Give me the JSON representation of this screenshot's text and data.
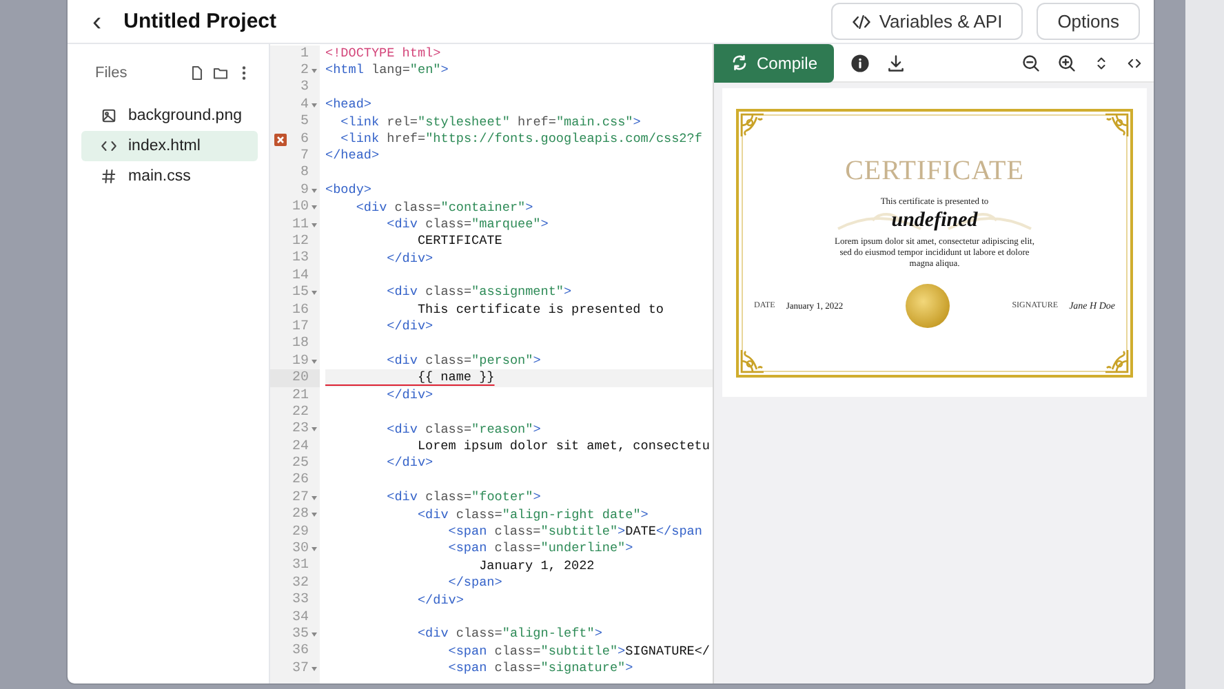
{
  "header": {
    "back": "‹",
    "title": "Untitled Project",
    "buttons": [
      {
        "kind": "code",
        "label": "Variables & API"
      },
      {
        "kind": "plain",
        "label": "Options"
      }
    ]
  },
  "files": {
    "title": "Files",
    "items": [
      {
        "kind": "image",
        "name": "background.png",
        "selected": false
      },
      {
        "kind": "code",
        "name": "index.html",
        "selected": true
      },
      {
        "kind": "hash",
        "name": "main.css",
        "selected": false
      }
    ]
  },
  "editor": {
    "lines": [
      {
        "number": "1",
        "fold": false,
        "text": "<!DOCTYPE html>"
      },
      {
        "number": "2",
        "fold": true,
        "text": "<html lang=\"en\">"
      },
      {
        "number": "3",
        "fold": false
      },
      {
        "number": "4",
        "fold": true,
        "text": "<head>"
      },
      {
        "number": "5",
        "fold": false,
        "text": "  <link rel=\"stylesheet\" href=\"main.css\">"
      },
      {
        "number": "6",
        "fold": false,
        "error": true,
        "text": "  <link href=\"https://fonts.googleapis.com/css2?f"
      },
      {
        "number": "7",
        "fold": false,
        "text": "</head>"
      },
      {
        "number": "8",
        "fold": false
      },
      {
        "number": "9",
        "fold": true,
        "text": "<body>"
      },
      {
        "number": "10",
        "fold": true,
        "text": "    <div class=\"container\">"
      },
      {
        "number": "11",
        "fold": true,
        "text": "        <div class=\"marquee\">"
      },
      {
        "number": "12",
        "fold": false,
        "text": "            CERTIFICATE"
      },
      {
        "number": "13",
        "fold": false,
        "text": "        </div>"
      },
      {
        "number": "14",
        "fold": false
      },
      {
        "number": "15",
        "fold": true,
        "text": "        <div class=\"assignment\">"
      },
      {
        "number": "16",
        "fold": false,
        "text": "            This certificate is presented to"
      },
      {
        "number": "17",
        "fold": false,
        "text": "        </div>"
      },
      {
        "number": "18",
        "fold": false
      },
      {
        "number": "19",
        "fold": true,
        "text": "        <div class=\"person\">"
      },
      {
        "number": "20",
        "fold": false,
        "current": true,
        "text": "            {{ name }}"
      },
      {
        "number": "21",
        "fold": false,
        "text": "        </div>"
      },
      {
        "number": "22",
        "fold": false
      },
      {
        "number": "23",
        "fold": true,
        "text": "        <div class=\"reason\">"
      },
      {
        "number": "24",
        "fold": false,
        "text": "            Lorem ipsum dolor sit amet, consectetu"
      },
      {
        "number": "25",
        "fold": false,
        "text": "        </div>"
      },
      {
        "number": "26",
        "fold": false
      },
      {
        "number": "27",
        "fold": true,
        "text": "        <div class=\"footer\">"
      },
      {
        "number": "28",
        "fold": true,
        "text": "            <div class=\"align-right date\">"
      },
      {
        "number": "29",
        "fold": false,
        "text": "                <span class=\"subtitle\">DATE</span"
      },
      {
        "number": "30",
        "fold": true,
        "text": "                <span class=\"underline\">"
      },
      {
        "number": "31",
        "fold": false,
        "text": "                    January 1, 2022"
      },
      {
        "number": "32",
        "fold": false,
        "text": "                </span>"
      },
      {
        "number": "33",
        "fold": false,
        "text": "            </div>"
      },
      {
        "number": "34",
        "fold": false
      },
      {
        "number": "35",
        "fold": true,
        "text": "            <div class=\"align-left\">"
      },
      {
        "number": "36",
        "fold": false,
        "text": "                <span class=\"subtitle\">SIGNATURE</"
      },
      {
        "number": "37",
        "fold": true,
        "text": "                <span class=\"signature\">"
      }
    ]
  },
  "preview": {
    "compile": "Compile",
    "certificate": {
      "title": "CERTIFICATE",
      "assignment": "This certificate is presented to",
      "person": "undefined",
      "reason": "Lorem ipsum dolor sit amet, consectetur adipiscing elit, sed do eiusmod tempor incididunt ut labore et dolore magna aliqua.",
      "date_label": "DATE",
      "date": "January 1, 2022",
      "signature_label": "SIGNATURE",
      "signature": "Jane H Doe"
    }
  }
}
